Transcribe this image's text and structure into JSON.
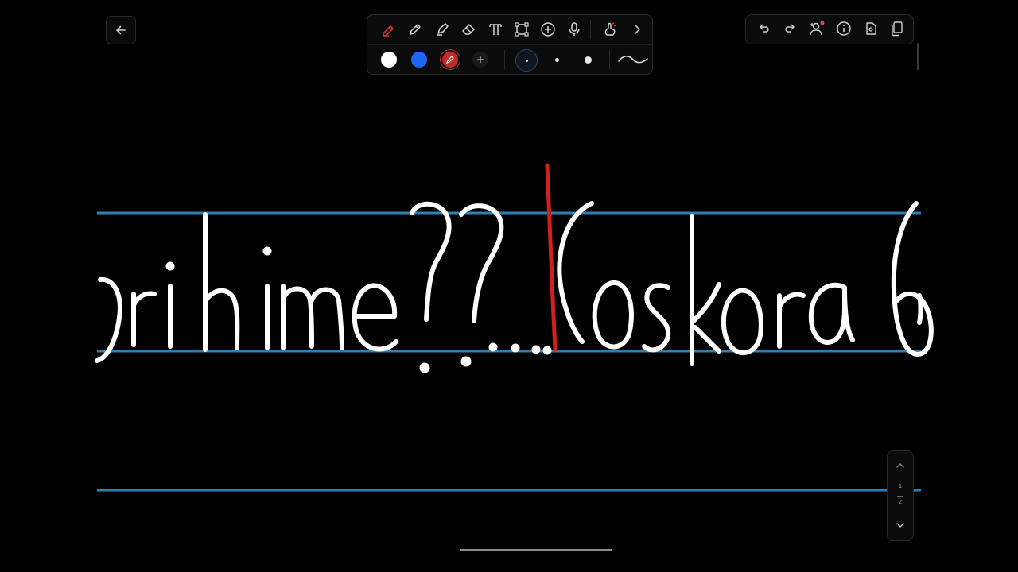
{
  "toolbar": {
    "tools": [
      {
        "icon": "pen-icon",
        "active": true
      },
      {
        "icon": "pencil-icon"
      },
      {
        "icon": "highlighter-icon"
      },
      {
        "icon": "eraser-icon"
      },
      {
        "icon": "text-icon"
      },
      {
        "icon": "shape-select-icon"
      },
      {
        "icon": "add-icon"
      },
      {
        "icon": "microphone-icon"
      },
      {
        "icon": "finger-draw-icon"
      },
      {
        "icon": "chevron-right-icon"
      }
    ],
    "colors": [
      "#ffffff",
      "#1e66f5",
      "#c42828"
    ],
    "selected_color": "#c42828",
    "stroke_sizes": [
      "small",
      "medium",
      "large"
    ],
    "selected_size": "small",
    "stroke_style_icon": "wave-stroke-icon"
  },
  "right_toolbar": {
    "icons": [
      "undo-icon",
      "redo-icon",
      "add-collaborator-icon",
      "info-icon",
      "page-settings-icon",
      "pages-icon"
    ]
  },
  "page_nav": {
    "current": "1",
    "total": "2"
  },
  "colors": {
    "background": "#000000",
    "ruled_line": "#2f7fb0",
    "ink_white": "#ffffff",
    "ink_red": "#d21f1f"
  }
}
